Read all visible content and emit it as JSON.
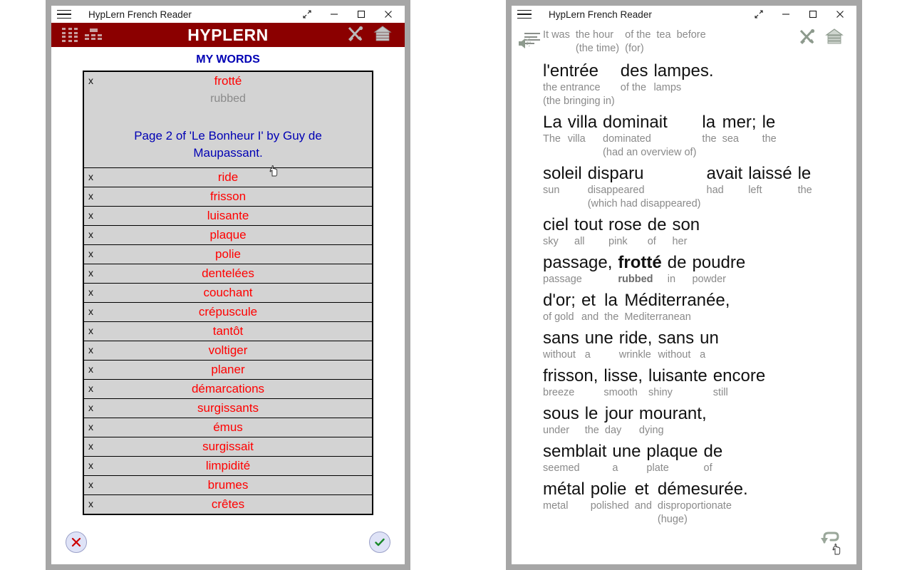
{
  "left_window": {
    "title": "HypLern French Reader",
    "menu_icon": "hamburger-icon",
    "controls": [
      "expand",
      "minimize",
      "maximize",
      "close"
    ],
    "toolbar": {
      "brand": "HYPLERN",
      "bg_color": "#8b0000",
      "left_icons": [
        "grid-icon",
        "grid-header-icon"
      ],
      "right_icons": [
        "tools-icon",
        "home-icon"
      ]
    },
    "section_title": "MY WORDS",
    "section_title_color": "#0000b4",
    "word_color": "#ff0000",
    "translation_color": "#8a8a8a",
    "page_note_color": "#0000b4",
    "expanded_row": {
      "delete_label": "x",
      "term": "frotté",
      "translation": "rubbed",
      "page_note": "Page 2 of 'Le Bonheur I' by Guy de Maupassant."
    },
    "rows": [
      {
        "delete_label": "x",
        "term": "ride"
      },
      {
        "delete_label": "x",
        "term": "frisson"
      },
      {
        "delete_label": "x",
        "term": "luisante"
      },
      {
        "delete_label": "x",
        "term": "plaque"
      },
      {
        "delete_label": "x",
        "term": "polie"
      },
      {
        "delete_label": "x",
        "term": "dentelées"
      },
      {
        "delete_label": "x",
        "term": "couchant"
      },
      {
        "delete_label": "x",
        "term": "crépuscule"
      },
      {
        "delete_label": "x",
        "term": "tantôt"
      },
      {
        "delete_label": "x",
        "term": "voltiger"
      },
      {
        "delete_label": "x",
        "term": "planer"
      },
      {
        "delete_label": "x",
        "term": "démarcations"
      },
      {
        "delete_label": "x",
        "term": "surgissants"
      },
      {
        "delete_label": "x",
        "term": "émus"
      },
      {
        "delete_label": "x",
        "term": "surgissait"
      },
      {
        "delete_label": "x",
        "term": "limpidité"
      },
      {
        "delete_label": "x",
        "term": "brumes"
      },
      {
        "delete_label": "x",
        "term": "crêtes"
      }
    ],
    "footer": {
      "cancel_icon": "close-x-icon",
      "confirm_icon": "check-icon",
      "cancel_color": "#cc0000",
      "confirm_color": "#1a8a2a"
    }
  },
  "right_window": {
    "title": "HypLern French Reader",
    "menu_icon": "hamburger-icon",
    "controls": [
      "expand",
      "minimize",
      "maximize",
      "close"
    ],
    "icons": {
      "lines": "lines-icon",
      "speaker": "speaker-icon",
      "tools": "tools-icon",
      "home": "home-icon",
      "undo": "undo-arrow-icon"
    },
    "reader_lines": [
      {
        "clipped": true,
        "tokens": [
          {
            "fr": "",
            "en": "It was",
            "en2": ""
          },
          {
            "fr": "",
            "en": "the hour",
            "en2": "(the time)"
          },
          {
            "fr": "",
            "en": "of the",
            "en2": "(for)"
          },
          {
            "fr": "",
            "en": "tea",
            "en2": ""
          },
          {
            "fr": "",
            "en": "before",
            "en2": ""
          }
        ]
      },
      {
        "tokens": [
          {
            "fr": "l'entrée",
            "en": "the entrance",
            "en2": "(the bringing in)"
          },
          {
            "fr": "des",
            "en": "of the",
            "en2": ""
          },
          {
            "fr": "lampes.",
            "en": "lamps",
            "en2": ""
          }
        ]
      },
      {
        "tokens": [
          {
            "fr": "La",
            "en": "The",
            "en2": ""
          },
          {
            "fr": "villa",
            "en": "villa",
            "en2": ""
          },
          {
            "fr": "dominait",
            "en": "dominated",
            "en2": "(had an overview of)"
          },
          {
            "fr": "la",
            "en": "the",
            "en2": ""
          },
          {
            "fr": "mer;",
            "en": "sea",
            "en2": ""
          },
          {
            "fr": "le",
            "en": "the",
            "en2": ""
          }
        ]
      },
      {
        "tokens": [
          {
            "fr": "soleil",
            "en": "sun",
            "en2": ""
          },
          {
            "fr": "disparu",
            "en": "disappeared",
            "en2": "(which had disappeared)"
          },
          {
            "fr": "avait",
            "en": "had",
            "en2": ""
          },
          {
            "fr": "laissé",
            "en": "left",
            "en2": ""
          },
          {
            "fr": "le",
            "en": "the",
            "en2": ""
          }
        ]
      },
      {
        "tokens": [
          {
            "fr": "ciel",
            "en": "sky",
            "en2": ""
          },
          {
            "fr": "tout",
            "en": "all",
            "en2": ""
          },
          {
            "fr": "rose",
            "en": "pink",
            "en2": ""
          },
          {
            "fr": "de",
            "en": "of",
            "en2": ""
          },
          {
            "fr": "son",
            "en": "her",
            "en2": ""
          }
        ]
      },
      {
        "tokens": [
          {
            "fr": "passage,",
            "en": "passage",
            "en2": ""
          },
          {
            "fr": "frotté",
            "en": "rubbed",
            "en2": "",
            "highlight": true
          },
          {
            "fr": "de",
            "en": "in",
            "en2": ""
          },
          {
            "fr": "poudre",
            "en": "powder",
            "en2": ""
          }
        ]
      },
      {
        "tokens": [
          {
            "fr": "d'or;",
            "en": "of gold",
            "en2": ""
          },
          {
            "fr": "et",
            "en": "and",
            "en2": ""
          },
          {
            "fr": "la",
            "en": "the",
            "en2": ""
          },
          {
            "fr": "Méditerranée,",
            "en": "Mediterranean",
            "en2": ""
          }
        ]
      },
      {
        "tokens": [
          {
            "fr": "sans",
            "en": "without",
            "en2": ""
          },
          {
            "fr": "une",
            "en": "a",
            "en2": ""
          },
          {
            "fr": "ride,",
            "en": "wrinkle",
            "en2": ""
          },
          {
            "fr": "sans",
            "en": "without",
            "en2": ""
          },
          {
            "fr": "un",
            "en": "a",
            "en2": ""
          }
        ]
      },
      {
        "tokens": [
          {
            "fr": "frisson,",
            "en": "breeze",
            "en2": ""
          },
          {
            "fr": "lisse,",
            "en": "smooth",
            "en2": ""
          },
          {
            "fr": "luisante",
            "en": "shiny",
            "en2": ""
          },
          {
            "fr": "encore",
            "en": "still",
            "en2": ""
          }
        ]
      },
      {
        "tokens": [
          {
            "fr": "sous",
            "en": "under",
            "en2": ""
          },
          {
            "fr": "le",
            "en": "the",
            "en2": ""
          },
          {
            "fr": "jour",
            "en": "day",
            "en2": ""
          },
          {
            "fr": "mourant,",
            "en": "dying",
            "en2": ""
          }
        ]
      },
      {
        "tokens": [
          {
            "fr": "semblait",
            "en": "seemed",
            "en2": ""
          },
          {
            "fr": "une",
            "en": "a",
            "en2": ""
          },
          {
            "fr": "plaque",
            "en": "plate",
            "en2": ""
          },
          {
            "fr": "de",
            "en": "of",
            "en2": ""
          }
        ]
      },
      {
        "tokens": [
          {
            "fr": "métal",
            "en": "metal",
            "en2": ""
          },
          {
            "fr": "polie",
            "en": "polished",
            "en2": ""
          },
          {
            "fr": "et",
            "en": "and",
            "en2": ""
          },
          {
            "fr": "démesurée.",
            "en": "disproportionate",
            "en2": "(huge)"
          }
        ]
      }
    ]
  }
}
